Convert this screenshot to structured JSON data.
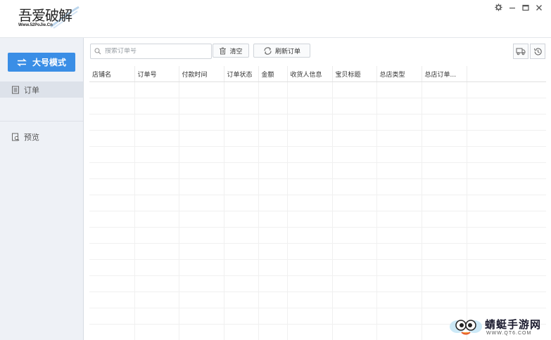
{
  "app": {
    "logo_text": "吾爱破解",
    "logo_subtext": "Www.52PoJie.Cn"
  },
  "window_controls": {
    "settings_icon": "gear-icon",
    "minimize_icon": "minimize-icon",
    "maximize_icon": "maximize-icon",
    "close_icon": "close-icon"
  },
  "sidebar": {
    "mode_button_label": "大号模式",
    "items": [
      {
        "label": "订单",
        "icon": "document-list-icon",
        "active": true
      },
      {
        "label": "预览",
        "icon": "preview-icon",
        "active": false
      }
    ]
  },
  "toolbar": {
    "search_placeholder": "搜索订单号",
    "clear_label": "清空",
    "refresh_label": "刷新订单"
  },
  "table": {
    "columns": [
      "店铺名",
      "订单号",
      "付款时间",
      "订单状态",
      "金额",
      "收货人信息",
      "宝贝标题",
      "总店类型",
      "总店订单..."
    ],
    "rows": []
  },
  "watermark": {
    "title": "蜻蜓手游网",
    "url": "WWW.QT6.COM"
  },
  "colors": {
    "accent": "#3a8ee6",
    "sidebar_bg": "#eef1f6",
    "active_item_bg": "#dde2ea"
  }
}
